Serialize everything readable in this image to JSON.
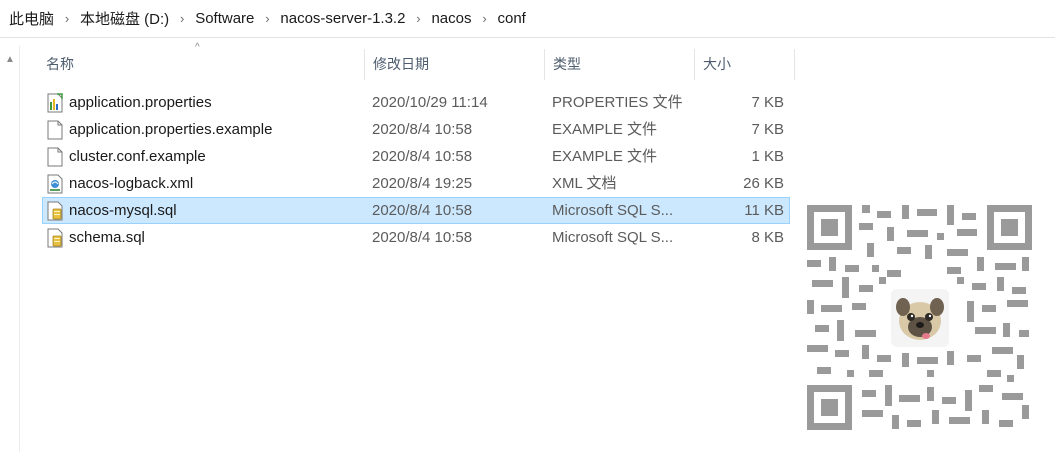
{
  "breadcrumb": {
    "items": [
      "此电脑",
      "本地磁盘 (D:)",
      "Software",
      "nacos-server-1.3.2",
      "nacos",
      "conf"
    ],
    "separator": "›"
  },
  "columns": {
    "name": "名称",
    "date": "修改日期",
    "type": "类型",
    "size": "大小"
  },
  "files": [
    {
      "name": "application.properties",
      "date": "2020/10/29 11:14",
      "type": "PROPERTIES 文件",
      "size": "7 KB",
      "icon": "properties-file-icon",
      "selected": false
    },
    {
      "name": "application.properties.example",
      "date": "2020/8/4 10:58",
      "type": "EXAMPLE 文件",
      "size": "7 KB",
      "icon": "blank-file-icon",
      "selected": false
    },
    {
      "name": "cluster.conf.example",
      "date": "2020/8/4 10:58",
      "type": "EXAMPLE 文件",
      "size": "1 KB",
      "icon": "blank-file-icon",
      "selected": false
    },
    {
      "name": "nacos-logback.xml",
      "date": "2020/8/4 19:25",
      "type": "XML 文档",
      "size": "26 KB",
      "icon": "xml-file-icon",
      "selected": false
    },
    {
      "name": "nacos-mysql.sql",
      "date": "2020/8/4 10:58",
      "type": "Microsoft SQL S...",
      "size": "11 KB",
      "icon": "sql-file-icon",
      "selected": true
    },
    {
      "name": "schema.sql",
      "date": "2020/8/4 10:58",
      "type": "Microsoft SQL S...",
      "size": "8 KB",
      "icon": "sql-file-icon",
      "selected": false
    }
  ],
  "colors": {
    "selection_bg": "#cce8ff",
    "selection_border": "#99d1ff",
    "header_text": "#4d5c6e",
    "qr_color": "#9a9a9a"
  }
}
